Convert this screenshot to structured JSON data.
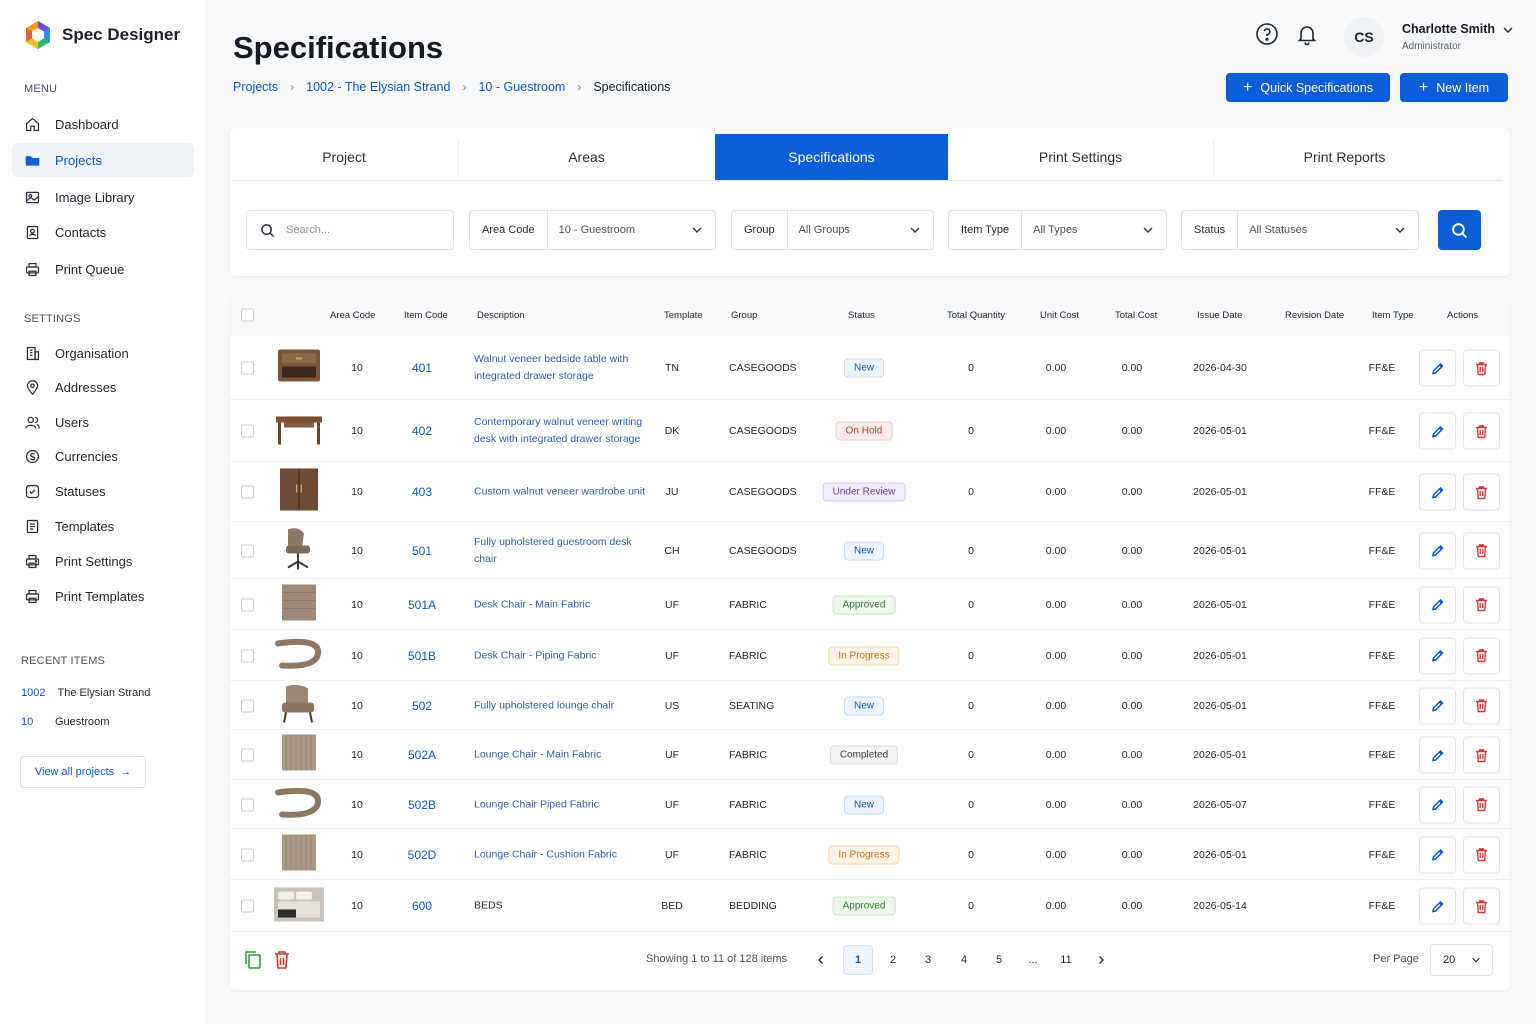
{
  "app": {
    "name": "Spec Designer"
  },
  "sidebar": {
    "menu_title": "MENU",
    "menu": [
      {
        "label": "Dashboard",
        "icon": "home-icon"
      },
      {
        "label": "Projects",
        "icon": "folder-icon",
        "active": true
      },
      {
        "label": "Image Library",
        "icon": "image-icon"
      },
      {
        "label": "Contacts",
        "icon": "contacts-icon"
      },
      {
        "label": "Print Queue",
        "icon": "printer-icon"
      }
    ],
    "settings_title": "SETTINGS",
    "settings": [
      {
        "label": "Organisation",
        "icon": "building-icon"
      },
      {
        "label": "Addresses",
        "icon": "location-pin-icon"
      },
      {
        "label": "Users",
        "icon": "users-icon"
      },
      {
        "label": "Currencies",
        "icon": "currency-icon"
      },
      {
        "label": "Statuses",
        "icon": "status-icon"
      },
      {
        "label": "Templates",
        "icon": "template-icon"
      },
      {
        "label": "Print Settings",
        "icon": "printer-settings-icon"
      },
      {
        "label": "Print Templates",
        "icon": "print-template-icon"
      }
    ],
    "recent_title": "RECENT ITEMS",
    "recent": [
      {
        "code": "1002",
        "label": "The Elysian Strand"
      },
      {
        "code": "10",
        "label": "Guestroom"
      }
    ],
    "view_all": "View all projects"
  },
  "header": {
    "title": "Specifications",
    "breadcrumb": [
      "Projects",
      "1002 - The Elysian Strand",
      "10 - Guestroom",
      "Specifications"
    ],
    "user": {
      "initials": "CS",
      "name": "Charlotte Smith",
      "role": "Administrator"
    },
    "quick_button": "Quick Specifications",
    "new_button": "New Item"
  },
  "tabs": [
    "Project",
    "Areas",
    "Specifications",
    "Print Settings",
    "Print Reports"
  ],
  "active_tab": "Specifications",
  "filters": {
    "search_placeholder": "Search...",
    "area_code": {
      "label": "Area Code",
      "value": "10 - Guestroom"
    },
    "group": {
      "label": "Group",
      "value": "All Groups"
    },
    "item_type": {
      "label": "Item Type",
      "value": "All Types"
    },
    "status": {
      "label": "Status",
      "value": "All Statuses"
    }
  },
  "table": {
    "columns": [
      "Area Code",
      "Item Code",
      "Description",
      "Template",
      "Group",
      "Status",
      "Total Quantity",
      "Unit Cost",
      "Total Cost",
      "Issue Date",
      "Revision Date",
      "Item Type",
      "Actions"
    ],
    "rows": [
      {
        "area": "10",
        "code": "401",
        "desc": "Walnut veneer bedside table with integrated drawer storage",
        "template": "TN",
        "group": "CASEGOODS",
        "status": "New",
        "qty": "0",
        "unit": "0.00",
        "total": "0.00",
        "issue": "2026-04-30",
        "revision": "",
        "type": "FF&E",
        "thumb": "nightstand"
      },
      {
        "area": "10",
        "code": "402",
        "desc": "Contemporary walnut veneer writing desk with integrated drawer storage",
        "template": "DK",
        "group": "CASEGOODS",
        "status": "On Hold",
        "qty": "0",
        "unit": "0.00",
        "total": "0.00",
        "issue": "2026-05-01",
        "revision": "",
        "type": "FF&E",
        "thumb": "desk"
      },
      {
        "area": "10",
        "code": "403",
        "desc": "Custom walnut veneer wardrobe unit",
        "template": "JU",
        "group": "CASEGOODS",
        "status": "Under Review",
        "qty": "0",
        "unit": "0.00",
        "total": "0.00",
        "issue": "2026-05-01",
        "revision": "",
        "type": "FF&E",
        "thumb": "wardrobe"
      },
      {
        "area": "10",
        "code": "501",
        "desc": "Fully upholstered guestroom desk chair",
        "template": "CH",
        "group": "CASEGOODS",
        "status": "New",
        "qty": "0",
        "unit": "0.00",
        "total": "0.00",
        "issue": "2026-05-01",
        "revision": "",
        "type": "FF&E",
        "thumb": "chair"
      },
      {
        "area": "10",
        "code": "501A",
        "desc": "Desk Chair - Main Fabric",
        "template": "UF",
        "group": "FABRIC",
        "status": "Approved",
        "qty": "0",
        "unit": "0.00",
        "total": "0.00",
        "issue": "2026-05-01",
        "revision": "",
        "type": "FF&E",
        "thumb": "fabric"
      },
      {
        "area": "10",
        "code": "501B",
        "desc": "Desk Chair - Piping Fabric",
        "template": "UF",
        "group": "FABRIC",
        "status": "In Progress",
        "qty": "0",
        "unit": "0.00",
        "total": "0.00",
        "issue": "2026-05-01",
        "revision": "",
        "type": "FF&E",
        "thumb": "piping"
      },
      {
        "area": "10",
        "code": "502",
        "desc": "Fully upholstered lounge chair",
        "template": "US",
        "group": "SEATING",
        "status": "New",
        "qty": "0",
        "unit": "0.00",
        "total": "0.00",
        "issue": "2026-05-01",
        "revision": "",
        "type": "FF&E",
        "thumb": "lounge"
      },
      {
        "area": "10",
        "code": "502A",
        "desc": "Lounge Chair - Main Fabric",
        "template": "UF",
        "group": "FABRIC",
        "status": "Completed",
        "qty": "0",
        "unit": "0.00",
        "total": "0.00",
        "issue": "2026-05-01",
        "revision": "",
        "type": "FF&E",
        "thumb": "fabric-stripe"
      },
      {
        "area": "10",
        "code": "502B",
        "desc": "Lounge Chair Piped Fabric",
        "template": "UF",
        "group": "FABRIC",
        "status": "New",
        "qty": "0",
        "unit": "0.00",
        "total": "0.00",
        "issue": "2026-05-07",
        "revision": "",
        "type": "FF&E",
        "thumb": "piping"
      },
      {
        "area": "10",
        "code": "502D",
        "desc": "Lounge Chair - Cushion Fabric",
        "template": "UF",
        "group": "FABRIC",
        "status": "In Progress",
        "qty": "0",
        "unit": "0.00",
        "total": "0.00",
        "issue": "2026-05-01",
        "revision": "",
        "type": "FF&E",
        "thumb": "fabric-stripe"
      },
      {
        "area": "10",
        "code": "600",
        "desc": "BEDS",
        "template": "BED",
        "group": "BEDDING",
        "status": "Approved",
        "qty": "0",
        "unit": "0.00",
        "total": "0.00",
        "issue": "2026-05-14",
        "revision": "",
        "type": "FF&E",
        "thumb": "bed"
      }
    ]
  },
  "pagination": {
    "showing": "Showing 1 to 11 of 128 items",
    "pages": [
      "1",
      "2",
      "3",
      "4",
      "5",
      "...",
      "11"
    ],
    "current": "1",
    "per_page_label": "Per Page",
    "per_page": "20"
  },
  "colors": {
    "accent": "#0b5ed7",
    "link": "#0b57c5",
    "danger": "#d23a33"
  }
}
